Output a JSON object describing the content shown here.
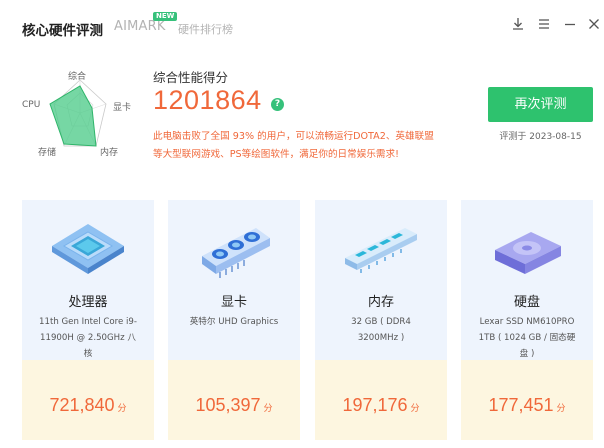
{
  "header": {
    "tabs": [
      "核心硬件评测",
      "AIMARK",
      "硬件排行榜"
    ],
    "new_badge": "NEW"
  },
  "radar": {
    "labels": {
      "top": "综合",
      "right": "显卡",
      "bottom_right": "内存",
      "bottom_left": "存储",
      "left": "CPU"
    }
  },
  "summary": {
    "title": "综合性能得分",
    "score": "1201864",
    "help": "?",
    "desc_line1": "此电脑击败了全国 93% 的用户，可以流畅运行DOTA2、英雄联盟",
    "desc_line2": "等大型联网游戏、PS等绘图软件，满足你的日常娱乐需求!",
    "retest_label": "再次评测",
    "date": "评测于 2023-08-15"
  },
  "cards": [
    {
      "name": "处理器",
      "desc1": "11th Gen Intel Core i9-",
      "desc2": "11900H @ 2.50GHz 八",
      "desc3": "核",
      "score": "721,840",
      "unit": "分"
    },
    {
      "name": "显卡",
      "desc1": "英特尔 UHD Graphics",
      "desc2": "",
      "desc3": "",
      "score": "105,397",
      "unit": "分"
    },
    {
      "name": "内存",
      "desc1": "32 GB ( DDR4",
      "desc2": "3200MHz )",
      "desc3": "",
      "score": "197,176",
      "unit": "分"
    },
    {
      "name": "硬盘",
      "desc1": "Lexar SSD NM610PRO",
      "desc2": "1TB ( 1024 GB / 固态硬",
      "desc3": "盘 )",
      "score": "177,451",
      "unit": "分"
    }
  ],
  "colors": {
    "accent_green": "#2ec26e",
    "score_orange": "#f0683a",
    "card_bg": "#eef4fd",
    "score_bg": "#fdf6e0"
  }
}
